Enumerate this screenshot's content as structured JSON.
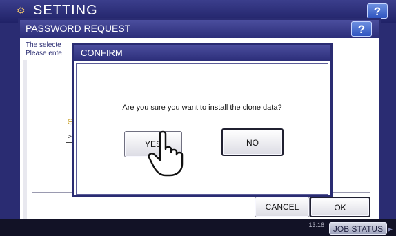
{
  "header": {
    "title": "SETTING",
    "help_label": "?"
  },
  "password_request": {
    "title": "PASSWORD REQUEST",
    "help_label": "?",
    "message_line1": "The selecte",
    "message_line2": "Please ente",
    "cancel_label": "CANCEL",
    "ok_label": "OK"
  },
  "confirm": {
    "title": "CONFIRM",
    "question": "Are you sure you want to install the clone data?",
    "yes_label": "YES",
    "no_label": "NO"
  },
  "footer": {
    "clock": "13:16",
    "job_status_label": "JOB STATUS"
  },
  "icons": [
    "settings-icon",
    "key-icon",
    "hand-pointer-icon",
    "help-icon"
  ],
  "colors": {
    "title_bar": "#2b2d78",
    "accent": "#2f55c0"
  }
}
